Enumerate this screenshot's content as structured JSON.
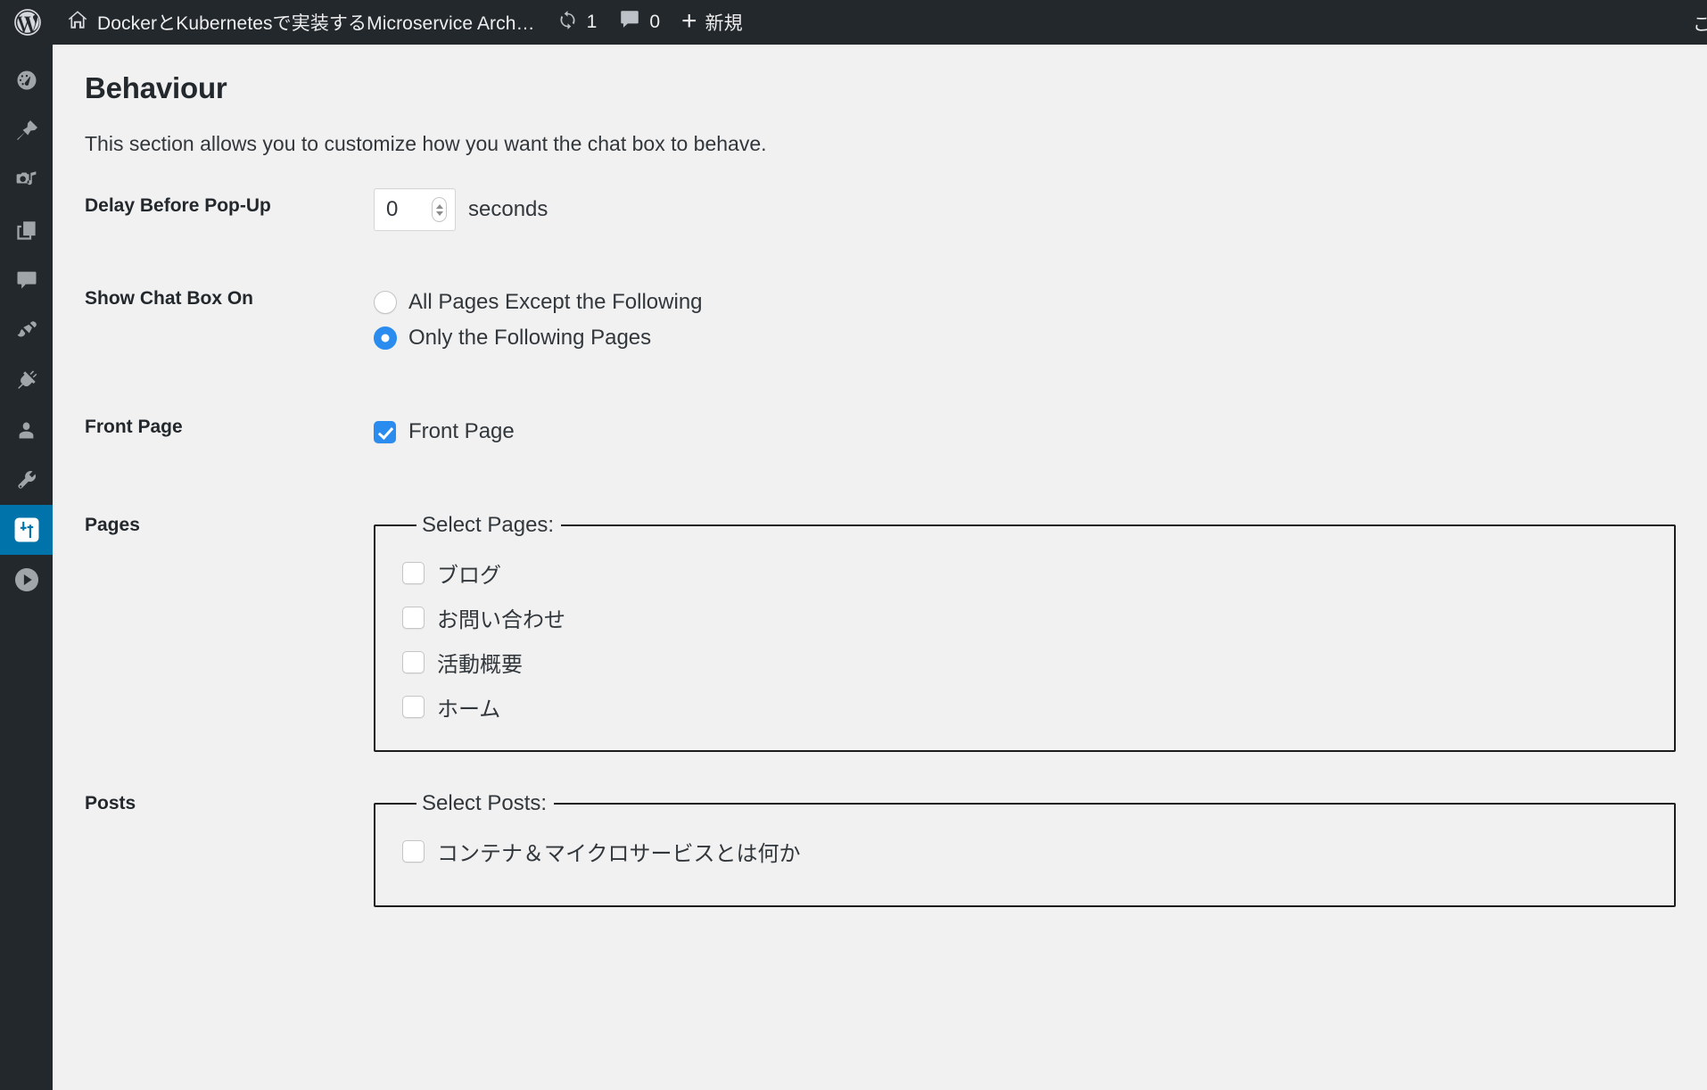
{
  "adminbar": {
    "logo_icon": "wordpress-logo-icon",
    "home_icon": "home-icon",
    "site_name": "DockerとKubernetesで実装するMicroservice Arch…",
    "updates_icon": "updates-icon",
    "updates_count": "1",
    "comments_icon": "comment-bubble-icon",
    "comments_count": "0",
    "new_icon": "plus-icon",
    "new_label": "新規",
    "howdy": "こ"
  },
  "sidebar": {
    "items": [
      {
        "name": "dashboard",
        "icon": "dashboard-icon",
        "current": false
      },
      {
        "name": "posts",
        "icon": "pin-icon",
        "current": false
      },
      {
        "name": "media",
        "icon": "media-icon",
        "current": false
      },
      {
        "name": "pages",
        "icon": "pages-icon",
        "current": false
      },
      {
        "name": "comments",
        "icon": "comments-icon",
        "current": false
      },
      {
        "name": "appearance",
        "icon": "paintbrush-icon",
        "current": false
      },
      {
        "name": "plugins",
        "icon": "plug-icon",
        "current": false
      },
      {
        "name": "users",
        "icon": "user-icon",
        "current": false
      },
      {
        "name": "tools",
        "icon": "wrench-icon",
        "current": false
      },
      {
        "name": "settings",
        "icon": "sliders-icon",
        "current": true
      },
      {
        "name": "media-play",
        "icon": "play-circle-icon",
        "current": false
      }
    ]
  },
  "page": {
    "title": "Behaviour",
    "description": "This section allows you to customize how you want the chat box to behave."
  },
  "fields": {
    "delay": {
      "label": "Delay Before Pop-Up",
      "value": "0",
      "unit": "seconds"
    },
    "show_chat_box_on": {
      "label": "Show Chat Box On",
      "options": [
        {
          "label": "All Pages Except the Following",
          "selected": false
        },
        {
          "label": "Only the Following Pages",
          "selected": true
        }
      ]
    },
    "front_page": {
      "label": "Front Page",
      "checkbox_label": "Front Page",
      "checked": true
    },
    "pages": {
      "label": "Pages",
      "legend": "Select Pages:",
      "items": [
        {
          "label": "ブログ",
          "checked": false
        },
        {
          "label": "お問い合わせ",
          "checked": false
        },
        {
          "label": "活動概要",
          "checked": false
        },
        {
          "label": "ホーム",
          "checked": false
        }
      ]
    },
    "posts": {
      "label": "Posts",
      "legend": "Select Posts:",
      "items": [
        {
          "label": "コンテナ＆マイクロサービスとは何か",
          "checked": false
        }
      ]
    }
  },
  "colors": {
    "admin_dark": "#23282d",
    "accent_blue": "#0073aa",
    "control_blue": "#2b8cf0",
    "page_bg": "#f1f1f1"
  }
}
